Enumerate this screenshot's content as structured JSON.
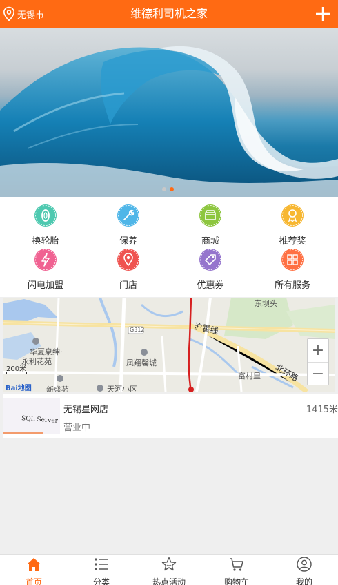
{
  "header": {
    "location": "无锡市",
    "title": "维德利司机之家"
  },
  "banner": {
    "active_dot": 1,
    "dot_count": 2
  },
  "services": [
    {
      "label": "换轮胎",
      "icon": "tire-icon",
      "color": "#4ec9b0"
    },
    {
      "label": "保养",
      "icon": "maintenance-icon",
      "color": "#4fb6e8"
    },
    {
      "label": "商城",
      "icon": "shop-icon",
      "color": "#8dc63f"
    },
    {
      "label": "推荐奖",
      "icon": "award-icon",
      "color": "#f7b731"
    },
    {
      "label": "闪电加盟",
      "icon": "lightning-icon",
      "color": "#f06292"
    },
    {
      "label": "门店",
      "icon": "store-location-icon",
      "color": "#ef5350"
    },
    {
      "label": "优惠券",
      "icon": "coupon-icon",
      "color": "#9575cd"
    },
    {
      "label": "所有服务",
      "icon": "all-services-icon",
      "color": "#ff7043"
    }
  ],
  "map": {
    "labels": {
      "dongbatou": "东坝头",
      "g312": "G312",
      "huhuoxian": "沪霍线",
      "huaxia": "华夏泉绅·",
      "yongli": "永利花苑",
      "fengxiang": "凤翔馨城",
      "fuzhuli": "富村里",
      "beihuanlu": "北环路",
      "xinshengyuan": "新盛苑",
      "tianhe": "天河小区"
    },
    "scale": "200米",
    "logo": "Bai地图",
    "zoom_in": "+",
    "zoom_out": "−"
  },
  "store": {
    "name": "无锡星网店",
    "distance": "1415米",
    "status": "营业中",
    "thumb_text": "SQL Server"
  },
  "tabs": [
    {
      "label": "首页",
      "icon": "home-icon",
      "active": true
    },
    {
      "label": "分类",
      "icon": "category-list-icon",
      "active": false
    },
    {
      "label": "热点活动",
      "icon": "star-icon",
      "active": false
    },
    {
      "label": "购物车",
      "icon": "cart-icon",
      "active": false
    },
    {
      "label": "我的",
      "icon": "user-icon",
      "active": false
    }
  ],
  "colors": {
    "brand": "#ff6a13",
    "route": "#d62020"
  }
}
